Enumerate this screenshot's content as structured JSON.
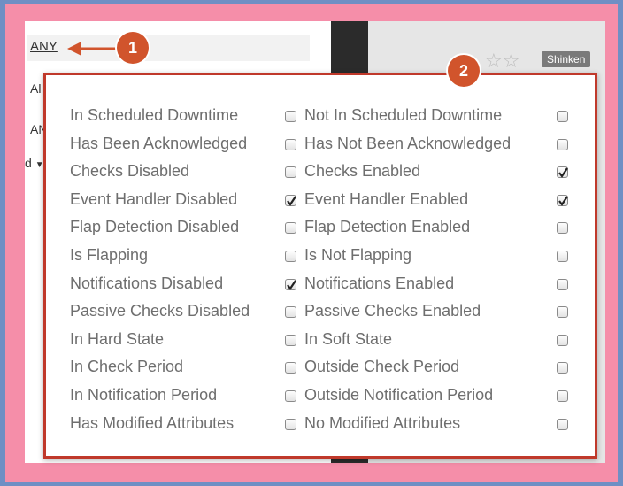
{
  "background_list": {
    "any_label": "ANY",
    "item_2_prefix": "Al",
    "item_3_prefix": "AN",
    "item_4_suffix": "d"
  },
  "header": {
    "badge_label": "Shinken"
  },
  "callouts": {
    "one": "1",
    "two": "2"
  },
  "filter_rows": [
    {
      "left_label": "In Scheduled Downtime",
      "left_checked": false,
      "right_label": "Not In Scheduled Downtime",
      "right_checked": false
    },
    {
      "left_label": "Has Been Acknowledged",
      "left_checked": false,
      "right_label": "Has Not Been Acknowledged",
      "right_checked": false
    },
    {
      "left_label": "Checks Disabled",
      "left_checked": false,
      "right_label": "Checks Enabled",
      "right_checked": true
    },
    {
      "left_label": "Event Handler Disabled",
      "left_checked": true,
      "right_label": "Event Handler Enabled",
      "right_checked": true
    },
    {
      "left_label": "Flap Detection Disabled",
      "left_checked": false,
      "right_label": "Flap Detection Enabled",
      "right_checked": false
    },
    {
      "left_label": "Is Flapping",
      "left_checked": false,
      "right_label": "Is Not Flapping",
      "right_checked": false
    },
    {
      "left_label": "Notifications Disabled",
      "left_checked": true,
      "right_label": "Notifications Enabled",
      "right_checked": false
    },
    {
      "left_label": "Passive Checks Disabled",
      "left_checked": false,
      "right_label": "Passive Checks Enabled",
      "right_checked": false
    },
    {
      "left_label": "In Hard State",
      "left_checked": false,
      "right_label": "In Soft State",
      "right_checked": false
    },
    {
      "left_label": "In Check Period",
      "left_checked": false,
      "right_label": "Outside Check Period",
      "right_checked": false
    },
    {
      "left_label": "In Notification Period",
      "left_checked": false,
      "right_label": "Outside Notification Period",
      "right_checked": false
    },
    {
      "left_label": "Has Modified Attributes",
      "left_checked": false,
      "right_label": "No Modified Attributes",
      "right_checked": false
    }
  ],
  "colors": {
    "callout": "#d1542c",
    "frame": "#f58ea9",
    "outer": "#6f8fc4",
    "popup_border": "#c0392b"
  }
}
